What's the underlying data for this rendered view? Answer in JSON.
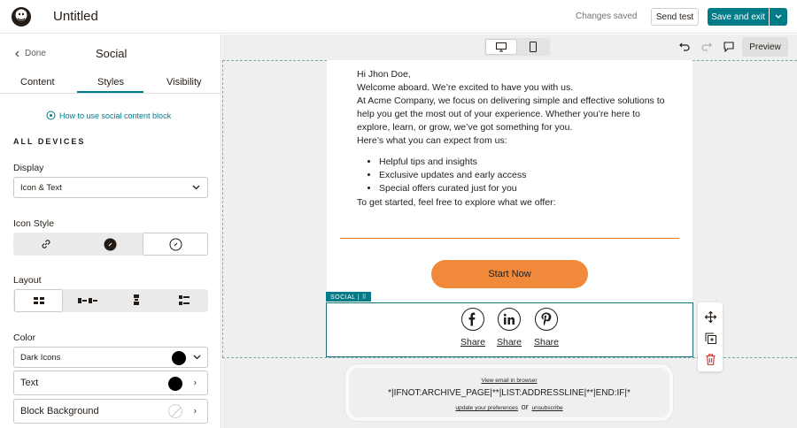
{
  "header": {
    "title": "Untitled",
    "status": "Changes saved",
    "send_test": "Send test",
    "save_exit": "Save and exit"
  },
  "panel": {
    "done": "Done",
    "title": "Social",
    "tabs": [
      "Content",
      "Styles",
      "Visibility"
    ],
    "active_tab": "Styles",
    "howto": "How to use social content block",
    "section": "ALL DEVICES",
    "display_label": "Display",
    "display_value": "Icon & Text",
    "icon_style_label": "Icon Style",
    "layout_label": "Layout",
    "color_label": "Color",
    "color_icons": "Dark Icons",
    "color_text": "Text",
    "color_block_bg": "Block Background"
  },
  "toolbar": {
    "preview": "Preview"
  },
  "email": {
    "greeting": "Hi Jhon Doe,",
    "welcome": "Welcome aboard. We’re excited to have you with us.",
    "paragraph": "At Acme Company, we focus on delivering simple and effective solutions to help you get the most out of your experience. Whether you’re here to explore, learn, or grow, we’ve got something for you.",
    "expect": "Here’s what you can expect from us:",
    "bullets": [
      "Helpful tips and insights",
      "Exclusive updates and early access",
      "Special offers curated just for you"
    ],
    "get_started": "To get started, feel free to explore what we offer:",
    "cta": "Start Now",
    "social_tag": "SOCIAL | ⠿",
    "share_labels": [
      "Share",
      "Share",
      "Share"
    ],
    "footer_view": "View email in browser",
    "footer_merge": "*|IFNOT:ARCHIVE_PAGE|**|LIST:ADDRESSLINE|**|END:IF|*",
    "footer_update": "update your preferences",
    "footer_or": "or",
    "footer_unsub": "unsubscribe"
  },
  "colors": {
    "accent": "#007c89",
    "cta": "#f1893b",
    "divider": "#e07d2d",
    "delete": "#d0342c"
  }
}
